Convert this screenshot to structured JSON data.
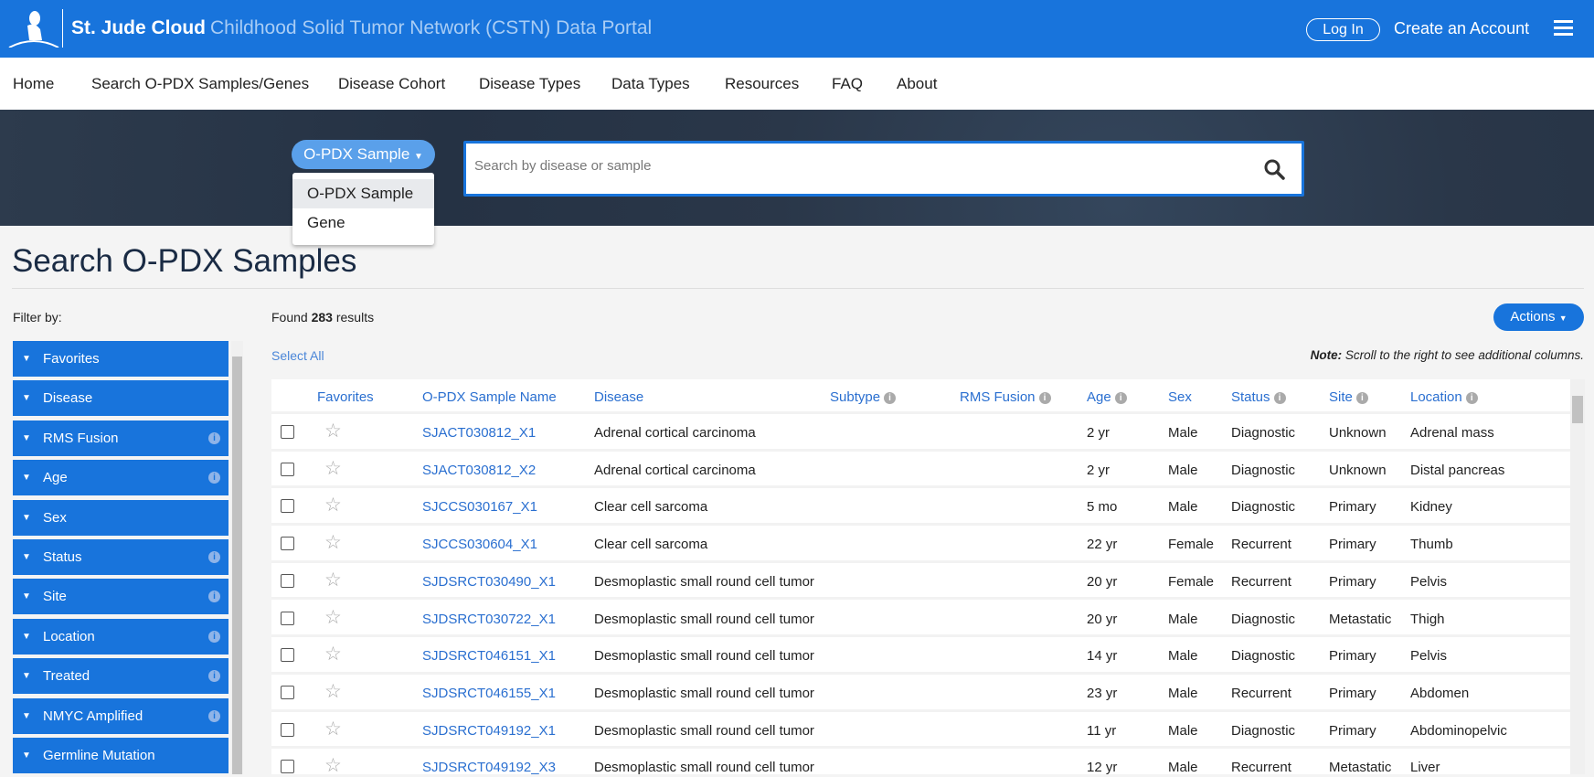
{
  "header": {
    "brand": "St. Jude Cloud",
    "portal": "Childhood Solid Tumor Network (CSTN) Data Portal",
    "login": "Log In",
    "create_account": "Create an Account"
  },
  "nav": [
    "Home",
    "Search O-PDX Samples/Genes",
    "Disease Cohort",
    "Disease Types",
    "Data Types",
    "Resources",
    "FAQ",
    "About"
  ],
  "search": {
    "dropdown_selected": "O-PDX Sample",
    "dropdown_options": [
      "O-PDX Sample",
      "Gene"
    ],
    "placeholder": "Search by disease or sample"
  },
  "page_title": "Search O-PDX Samples",
  "filter_label": "Filter by:",
  "filters": [
    {
      "label": "Favorites",
      "info": false
    },
    {
      "label": "Disease",
      "info": false
    },
    {
      "label": "RMS Fusion",
      "info": true
    },
    {
      "label": "Age",
      "info": true
    },
    {
      "label": "Sex",
      "info": false
    },
    {
      "label": "Status",
      "info": true
    },
    {
      "label": "Site",
      "info": true
    },
    {
      "label": "Location",
      "info": true
    },
    {
      "label": "Treated",
      "info": true
    },
    {
      "label": "NMYC Amplified",
      "info": true
    },
    {
      "label": "Germline Mutation",
      "info": false
    }
  ],
  "results": {
    "prefix": "Found",
    "count": "283",
    "suffix": "results"
  },
  "actions_label": "Actions",
  "select_all": "Select All",
  "note": {
    "bold": "Note:",
    "text": " Scroll to the right to see additional columns."
  },
  "table": {
    "columns": [
      {
        "label": "Favorites",
        "info": false
      },
      {
        "label": "O-PDX Sample Name",
        "info": false
      },
      {
        "label": "Disease",
        "info": false
      },
      {
        "label": "Subtype",
        "info": true
      },
      {
        "label": "RMS Fusion",
        "info": true
      },
      {
        "label": "Age",
        "info": true
      },
      {
        "label": "Sex",
        "info": false
      },
      {
        "label": "Status",
        "info": true
      },
      {
        "label": "Site",
        "info": true
      },
      {
        "label": "Location",
        "info": true
      }
    ],
    "rows": [
      [
        "SJACT030812_X1",
        "Adrenal cortical carcinoma",
        "",
        "",
        "2 yr",
        "Male",
        "Diagnostic",
        "Unknown",
        "Adrenal mass"
      ],
      [
        "SJACT030812_X2",
        "Adrenal cortical carcinoma",
        "",
        "",
        "2 yr",
        "Male",
        "Diagnostic",
        "Unknown",
        "Distal pancreas"
      ],
      [
        "SJCCS030167_X1",
        "Clear cell sarcoma",
        "",
        "",
        "5 mo",
        "Male",
        "Diagnostic",
        "Primary",
        "Kidney"
      ],
      [
        "SJCCS030604_X1",
        "Clear cell sarcoma",
        "",
        "",
        "22 yr",
        "Female",
        "Recurrent",
        "Primary",
        "Thumb"
      ],
      [
        "SJDSRCT030490_X1",
        "Desmoplastic small round cell tumor",
        "",
        "",
        "20 yr",
        "Female",
        "Recurrent",
        "Primary",
        "Pelvis"
      ],
      [
        "SJDSRCT030722_X1",
        "Desmoplastic small round cell tumor",
        "",
        "",
        "20 yr",
        "Male",
        "Diagnostic",
        "Metastatic",
        "Thigh"
      ],
      [
        "SJDSRCT046151_X1",
        "Desmoplastic small round cell tumor",
        "",
        "",
        "14 yr",
        "Male",
        "Diagnostic",
        "Primary",
        "Pelvis"
      ],
      [
        "SJDSRCT046155_X1",
        "Desmoplastic small round cell tumor",
        "",
        "",
        "23 yr",
        "Male",
        "Recurrent",
        "Primary",
        "Abdomen"
      ],
      [
        "SJDSRCT049192_X1",
        "Desmoplastic small round cell tumor",
        "",
        "",
        "11 yr",
        "Male",
        "Diagnostic",
        "Primary",
        "Abdominopelvic"
      ],
      [
        "SJDSRCT049192_X3",
        "Desmoplastic small round cell tumor",
        "",
        "",
        "12 yr",
        "Male",
        "Recurrent",
        "Metastatic",
        "Liver"
      ]
    ]
  },
  "colors": {
    "brand_blue": "#1874dc",
    "link_blue": "#2a6fd0",
    "banner": "#2a3749"
  }
}
